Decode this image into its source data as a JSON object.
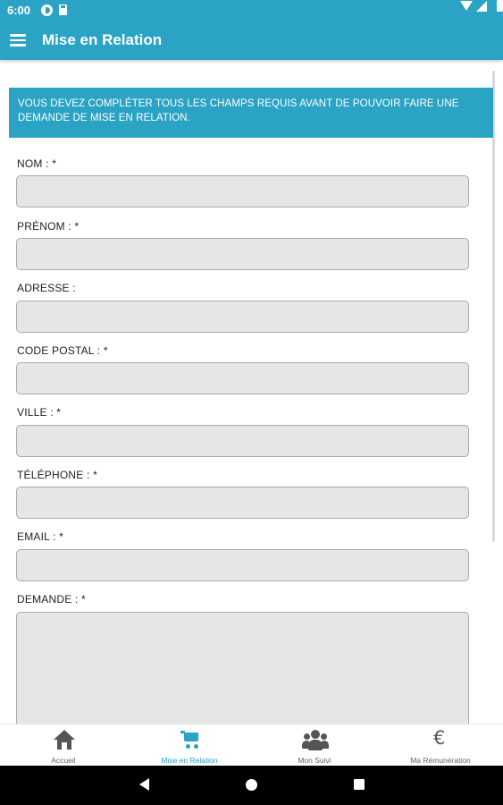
{
  "status_bar": {
    "time": "6:00"
  },
  "app_bar": {
    "title": "Mise en Relation",
    "menu_icon": "menu-icon"
  },
  "notice": {
    "text": "VOUS DEVEZ COMPLÉTER TOUS LES CHAMPS REQUIS AVANT DE POUVOIR FAIRE UNE DEMANDE DE MISE EN RELATION."
  },
  "form": {
    "fields": [
      {
        "label": "NOM : *",
        "value": "",
        "required": true
      },
      {
        "label": "PRÉNOM : *",
        "value": "",
        "required": true
      },
      {
        "label": "ADRESSE :",
        "value": "",
        "required": false
      },
      {
        "label": "CODE POSTAL : *",
        "value": "",
        "required": true
      },
      {
        "label": "VILLE : *",
        "value": "",
        "required": true
      },
      {
        "label": "TÉLÉPHONE : *",
        "value": "",
        "required": true
      },
      {
        "label": "EMAIL : *",
        "value": "",
        "required": true
      }
    ],
    "demande": {
      "label": "DEMANDE : *",
      "value": "",
      "required": true
    }
  },
  "bottom_nav": {
    "items": [
      {
        "label": "Accueil",
        "icon": "home-icon",
        "active": false
      },
      {
        "label": "Mise en Relation",
        "icon": "cart-icon",
        "active": true
      },
      {
        "label": "Mon Suivi",
        "icon": "group-icon",
        "active": false
      },
      {
        "label": "Ma Rémunération",
        "icon": "euro-icon",
        "active": false
      }
    ]
  },
  "colors": {
    "accent": "#2aa3c4",
    "input_background": "#e6e6e6",
    "input_border": "#a9a9a9",
    "label_text": "#222222",
    "nav_inactive": "#666666"
  }
}
